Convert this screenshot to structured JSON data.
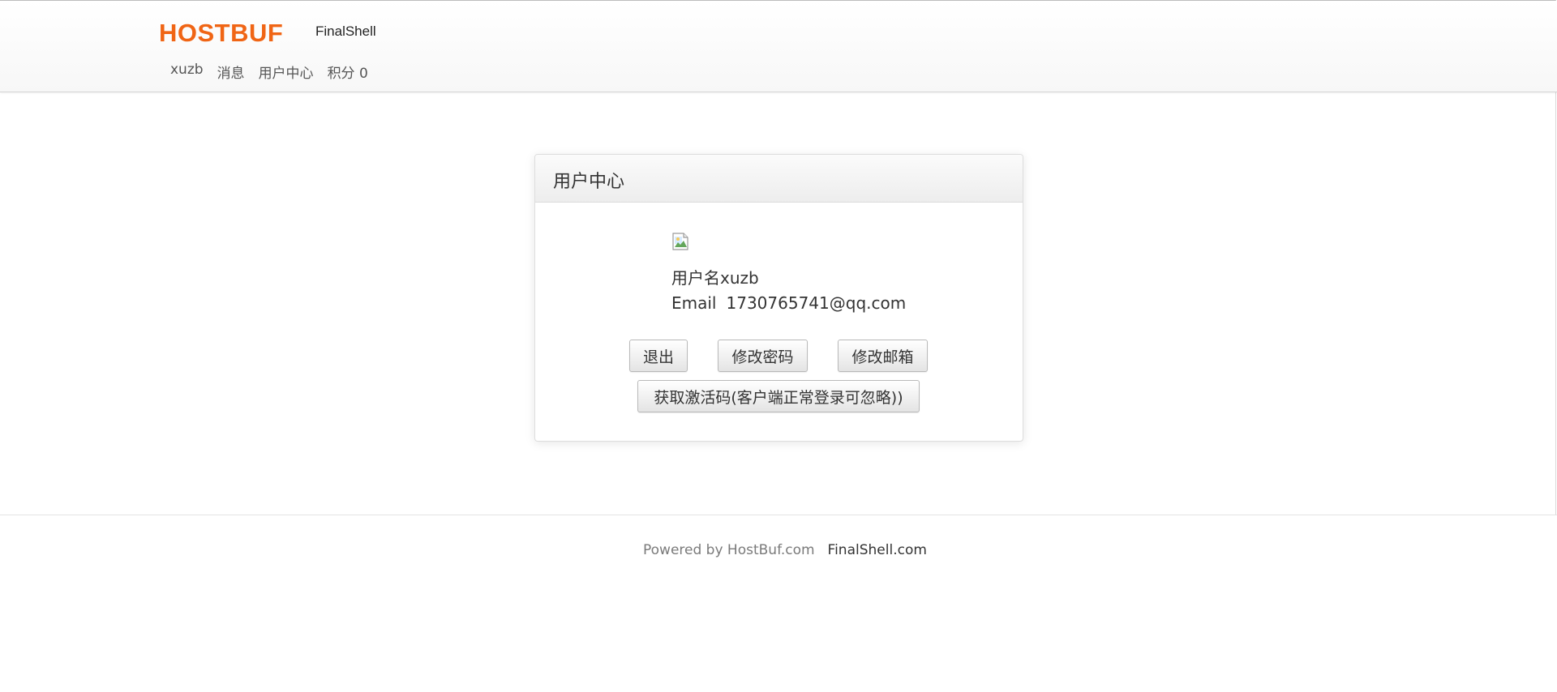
{
  "header": {
    "brand": "HOSTBUF",
    "product_link": "FinalShell",
    "nav": {
      "username": "xuzb",
      "messages": "消息",
      "user_center": "用户中心",
      "points": "积分 0"
    }
  },
  "panel": {
    "title": "用户中心",
    "username_line": "用户名xuzb",
    "email_label": "Email",
    "email_value": "1730765741@qq.com",
    "buttons": {
      "logout": "退出",
      "change_password": "修改密码",
      "change_email": "修改邮箱",
      "activation": "获取激活码(客户端正常登录可忽略))"
    }
  },
  "footer": {
    "powered_by": "Powered by HostBuf.com",
    "link": "FinalShell.com"
  },
  "colors": {
    "brand": "#f06515",
    "text": "#333333",
    "muted": "#7a7a7a"
  },
  "icons": {
    "avatar": "broken-image-icon"
  }
}
